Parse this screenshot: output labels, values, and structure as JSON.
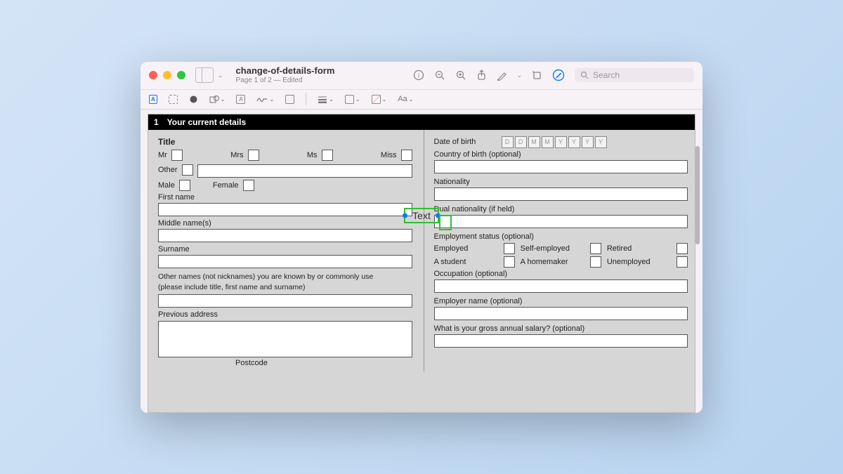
{
  "window": {
    "title": "change-of-details-form",
    "subtitle": "Page 1 of 2 — Edited",
    "search_placeholder": "Search"
  },
  "section": {
    "number": "1",
    "title": "Your current details"
  },
  "left": {
    "title_label": "Title",
    "mr": "Mr",
    "mrs": "Mrs",
    "ms": "Ms",
    "miss": "Miss",
    "other": "Other",
    "male": "Male",
    "female": "Female",
    "first_name": "First name",
    "middle_names": "Middle name(s)",
    "surname": "Surname",
    "other_names_1": "Other names (not nicknames) you are known by or commonly use",
    "other_names_2": "(please include title, first name and surname)",
    "previous_address": "Previous address",
    "postcode": "Postcode"
  },
  "right": {
    "dob": "Date of birth",
    "dob_placeholders": [
      "D",
      "D",
      "M",
      "M",
      "Y",
      "Y",
      "Y",
      "Y"
    ],
    "country_of_birth": "Country of birth (optional)",
    "nationality": "Nationality",
    "dual_nationality": "Dual nationality (if held)",
    "employment_status": "Employment status (optional)",
    "employed": "Employed",
    "self_employed": "Self-employed",
    "retired": "Retired",
    "student": "A student",
    "homemaker": "A homemaker",
    "unemployed": "Unemployed",
    "occupation": "Occupation (optional)",
    "employer_name": "Employer name (optional)",
    "gross_salary": "What is your gross annual salary? (optional)"
  },
  "annotation": {
    "text": "Text"
  }
}
